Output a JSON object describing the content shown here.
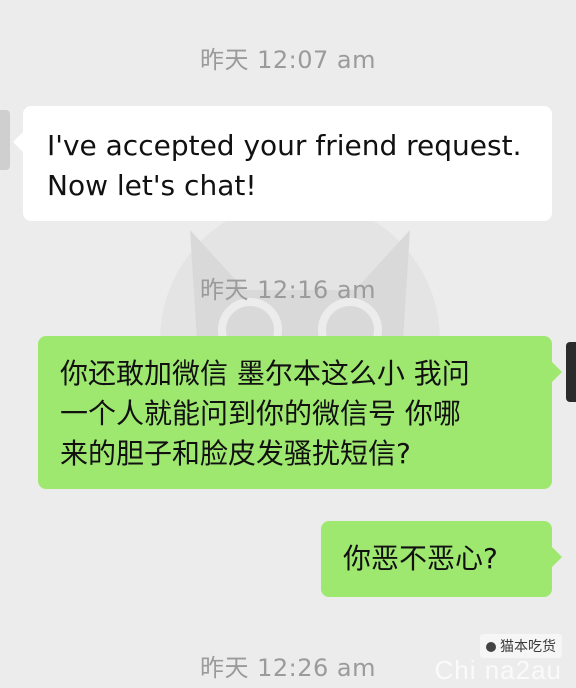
{
  "messages": [
    {
      "type": "timestamp",
      "text": "昨天 12:07 am"
    },
    {
      "type": "incoming",
      "lines": [
        "I've accepted your friend request.",
        "Now let's chat!"
      ]
    },
    {
      "type": "timestamp",
      "text": "昨天 12:16 am"
    },
    {
      "type": "outgoing",
      "lines": [
        "你还敢加微信 墨尔本这么小 我问",
        "一个人就能问到你的微信号 你哪",
        "来的胆子和脸皮发骚扰短信?"
      ]
    },
    {
      "type": "outgoing",
      "lines": [
        "你恶不恶心?"
      ]
    },
    {
      "type": "timestamp",
      "text": "昨天 12:26 am"
    }
  ],
  "watermark": {
    "brand": "猫本吃货",
    "site": "Chi na2au"
  },
  "colors": {
    "background": "#ececec",
    "incoming_bubble": "#ffffff",
    "outgoing_bubble": "#9fe870",
    "timestamp": "#9b9b9b"
  }
}
